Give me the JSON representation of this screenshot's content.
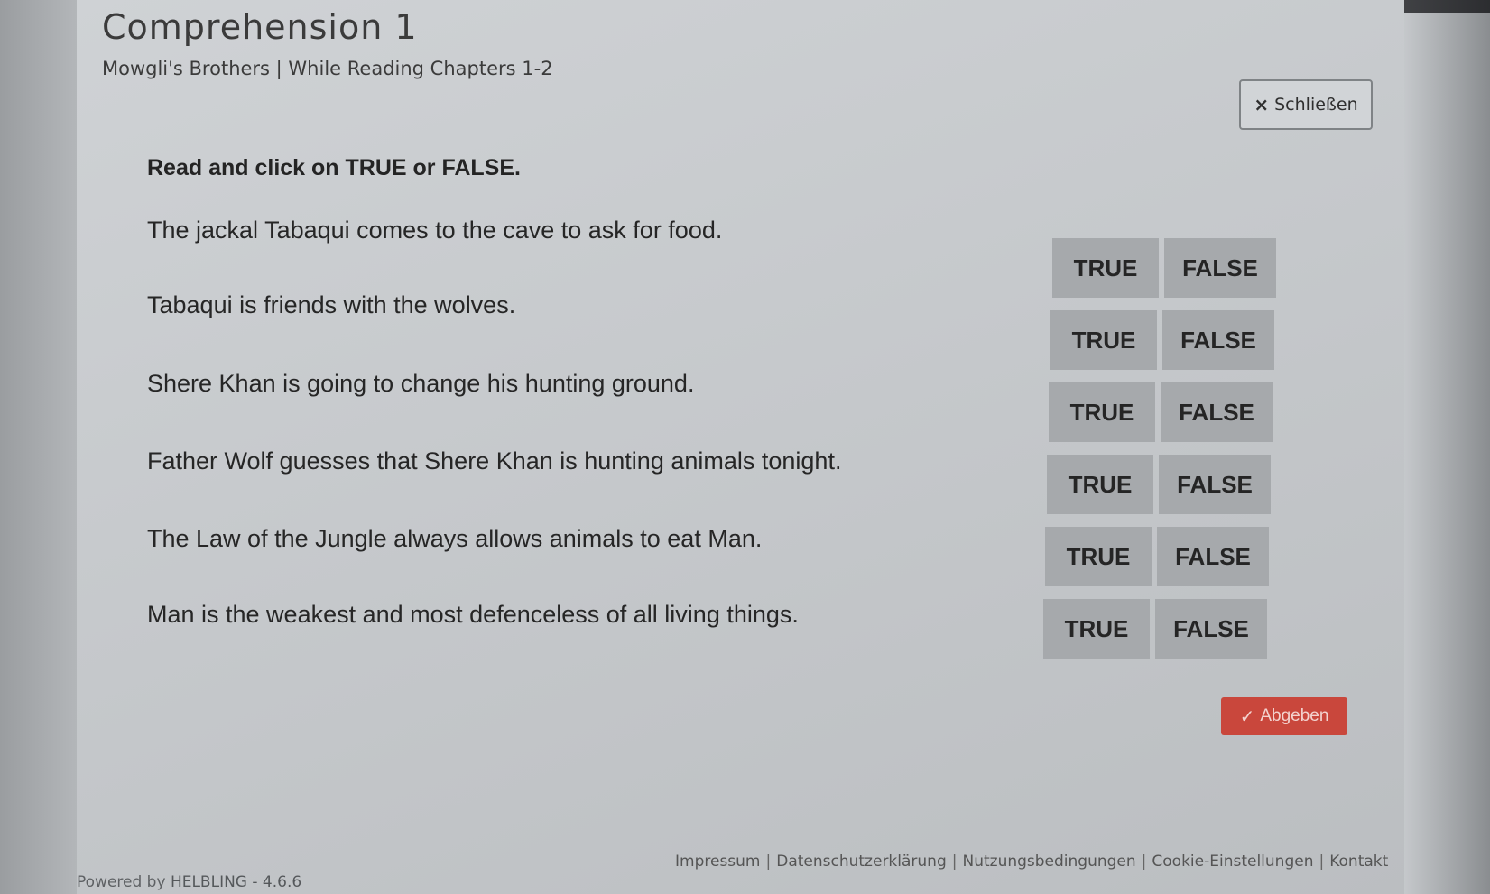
{
  "header": {
    "title": "Comprehension 1",
    "subtitle": "Mowgli's Brothers | While Reading Chapters 1-2",
    "close_icon": "×",
    "close_label": "Schließen"
  },
  "exercise": {
    "instruction": "Read and click on TRUE or FALSE.",
    "true_label": "TRUE",
    "false_label": "FALSE",
    "statements": [
      "The jackal Tabaqui comes to the cave to ask for food.",
      "Tabaqui is friends with the wolves.",
      "Shere Khan is going to change his hunting ground.",
      "Father Wolf guesses that Shere Khan is hunting animals tonight.",
      "The Law of the Jungle always allows animals to eat Man.",
      "Man is the weakest and most defenceless of all living things."
    ]
  },
  "submit": {
    "icon": "✓",
    "label": "Abgeben"
  },
  "footer": {
    "powered_prefix": "Powered by ",
    "powered_brand": "HELBLING - 4.6.6",
    "links": [
      "Impressum",
      "Datenschutzerklärung",
      "Nutzungsbedingungen",
      "Cookie-Einstellungen",
      "Kontakt"
    ]
  },
  "colors": {
    "submit": "#c9473c",
    "answer_button": "#a6a9ac"
  }
}
